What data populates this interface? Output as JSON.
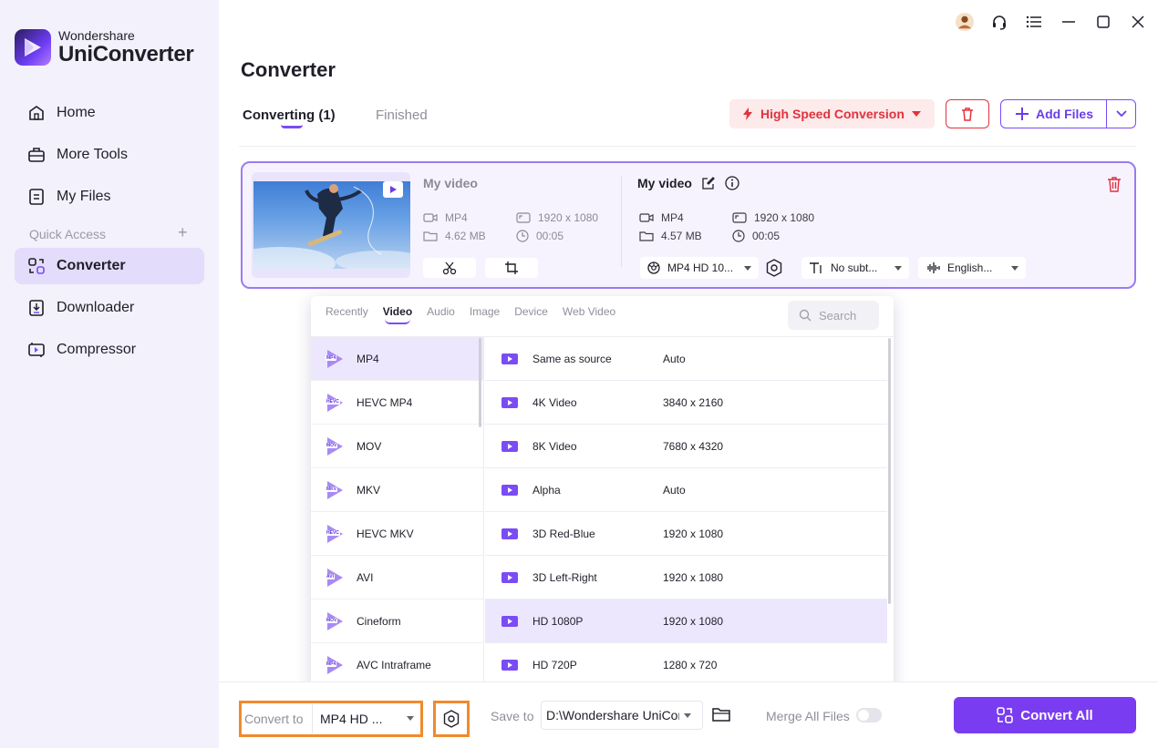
{
  "app": {
    "brand_small": "Wondershare",
    "brand_big": "UniConverter"
  },
  "sidebar": {
    "items": [
      {
        "label": "Home",
        "icon": "home-icon"
      },
      {
        "label": "More Tools",
        "icon": "toolbox-icon"
      },
      {
        "label": "My Files",
        "icon": "files-icon"
      },
      {
        "label": "Converter",
        "icon": "converter-icon",
        "active": true
      },
      {
        "label": "Downloader",
        "icon": "downloader-icon"
      },
      {
        "label": "Compressor",
        "icon": "compressor-icon"
      }
    ],
    "quick_access": "Quick Access"
  },
  "header": {
    "title": "Converter",
    "tabs": [
      {
        "label": "Converting (1)",
        "active": true
      },
      {
        "label": "Finished"
      }
    ],
    "high_speed": "High Speed Conversion",
    "add_files": "Add Files"
  },
  "file": {
    "source": {
      "name": "My video",
      "format": "MP4",
      "size": "4.62 MB",
      "resolution": "1920 x 1080",
      "duration": "00:05"
    },
    "target": {
      "name": "My video",
      "format": "MP4",
      "size": "4.57 MB",
      "resolution": "1920 x 1080",
      "duration": "00:05"
    },
    "output_format": "MP4 HD 10...",
    "subtitle": "No subt...",
    "audio": "English..."
  },
  "format_popup": {
    "tabs": [
      {
        "label": "Recently"
      },
      {
        "label": "Video",
        "active": true
      },
      {
        "label": "Audio"
      },
      {
        "label": "Image"
      },
      {
        "label": "Device"
      },
      {
        "label": "Web Video"
      }
    ],
    "search_placeholder": "Search",
    "formats": [
      {
        "label": "MP4",
        "badge": "MP4",
        "active": true
      },
      {
        "label": "HEVC MP4",
        "badge": "HEVC"
      },
      {
        "label": "MOV",
        "badge": "MOV"
      },
      {
        "label": "MKV",
        "badge": "MKV"
      },
      {
        "label": "HEVC MKV",
        "badge": "HEVC"
      },
      {
        "label": "AVI",
        "badge": "AVI"
      },
      {
        "label": "Cineform",
        "badge": "MOV"
      },
      {
        "label": "AVC Intraframe",
        "badge": "MP4"
      }
    ],
    "presets": [
      {
        "name": "Same as source",
        "resolution": "Auto"
      },
      {
        "name": "4K Video",
        "resolution": "3840 x 2160"
      },
      {
        "name": "8K Video",
        "resolution": "7680 x 4320"
      },
      {
        "name": "Alpha",
        "resolution": "Auto"
      },
      {
        "name": "3D Red-Blue",
        "resolution": "1920 x 1080"
      },
      {
        "name": "3D Left-Right",
        "resolution": "1920 x 1080"
      },
      {
        "name": "HD 1080P",
        "resolution": "1920 x 1080",
        "active": true
      },
      {
        "name": "HD 720P",
        "resolution": "1280 x 720"
      }
    ]
  },
  "footer": {
    "convert_to_label": "Convert to",
    "convert_to_value": "MP4 HD ...",
    "save_to_label": "Save to",
    "save_to_value": "D:\\Wondershare UniConverter",
    "merge_label": "Merge All Files",
    "convert_all": "Convert All"
  },
  "colors": {
    "accent": "#7a3cf0",
    "danger": "#e1323d",
    "highlight": "#f08a2c",
    "sidebar_bg": "#f3f1fb"
  }
}
